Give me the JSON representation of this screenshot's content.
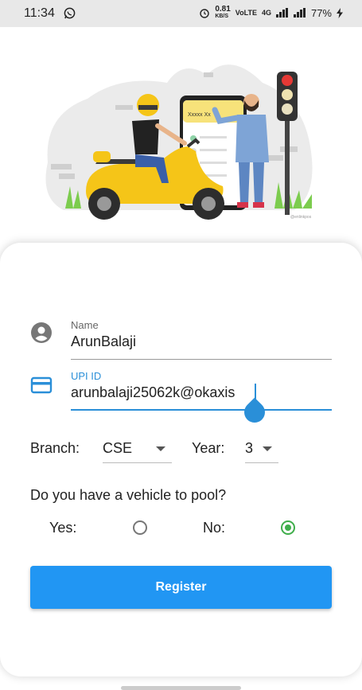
{
  "status_bar": {
    "time": "11:34",
    "network_speed": "0.81",
    "network_unit": "KB/S",
    "volte": "VoLTE",
    "signal_4g": "4G",
    "battery": "77%"
  },
  "form": {
    "name": {
      "label": "Name",
      "value": "ArunBalaji",
      "icon": "account-circle-icon"
    },
    "upi": {
      "label": "UPI ID",
      "value": "arunbalaji25062k@okaxis",
      "icon": "credit-card-icon"
    },
    "branch": {
      "label": "Branch:",
      "value": "CSE"
    },
    "year": {
      "label": "Year:",
      "value": "3"
    },
    "vehicle_question": "Do you have a vehicle to pool?",
    "yes_label": "Yes:",
    "no_label": "No:",
    "selected": "No",
    "register_label": "Register"
  },
  "illustration": {
    "credit": "@enlinkpos",
    "phone_text": "Xxxxx Xx"
  },
  "colors": {
    "accent": "#2196f3",
    "radio_selected": "#3fae4b",
    "scooter": "#f5c518"
  }
}
